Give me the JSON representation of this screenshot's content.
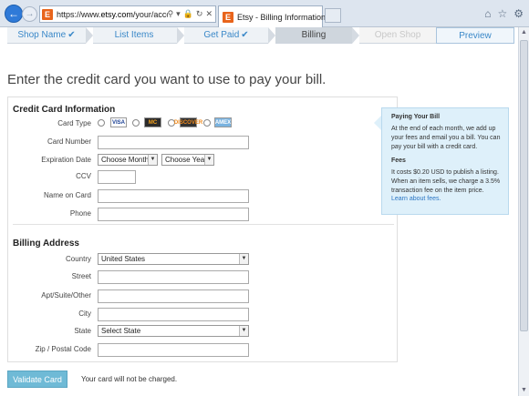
{
  "browser": {
    "url_prefix": "https://www.",
    "url_domain": "etsy.com",
    "url_path": "/your/account/billing",
    "tab_title": "Etsy - Billing Information",
    "favicon_letter": "E",
    "tab_favicon_letter": "E"
  },
  "steps": [
    {
      "label": "Shop Name",
      "state": "done",
      "check": "✔"
    },
    {
      "label": "List Items",
      "state": "done",
      "check": ""
    },
    {
      "label": "Get Paid",
      "state": "done",
      "check": "✔"
    },
    {
      "label": "Billing",
      "state": "active",
      "check": ""
    },
    {
      "label": "Open Shop",
      "state": "future",
      "check": ""
    },
    {
      "label": "Preview",
      "state": "preview",
      "check": ""
    }
  ],
  "page": {
    "title": "Enter the credit card you want to use to pay your bill."
  },
  "credit": {
    "section_title": "Credit Card Information",
    "card_type_label": "Card Type",
    "cards": [
      "VISA",
      "MC",
      "DISCOVER",
      "AMEX"
    ],
    "card_number_label": "Card Number",
    "expiration_label": "Expiration Date",
    "month_value": "Choose Month",
    "year_value": "Choose Year",
    "ccv_label": "CCV",
    "name_label": "Name on Card",
    "phone_label": "Phone"
  },
  "billing": {
    "section_title": "Billing Address",
    "country_label": "Country",
    "country_value": "United States",
    "street_label": "Street",
    "apt_label": "Apt/Suite/Other",
    "city_label": "City",
    "state_label": "State",
    "state_value": "Select State",
    "zip_label": "Zip / Postal Code"
  },
  "info": {
    "paying_title": "Paying Your Bill",
    "paying_text": "At the end of each month, we add up your fees and email you a bill. You can pay your bill with a credit card.",
    "fees_title": "Fees",
    "fees_text": "It costs $0.20 USD to publish a listing. When an item sells, we charge a 3.5% transaction fee on the item price.",
    "fees_link": "Learn about fees."
  },
  "actions": {
    "validate_label": "Validate Card",
    "note": "Your card will not be charged."
  },
  "colors": {
    "accent": "#3a88c8",
    "button": "#6fbad6",
    "info_bg": "#def0fa"
  }
}
